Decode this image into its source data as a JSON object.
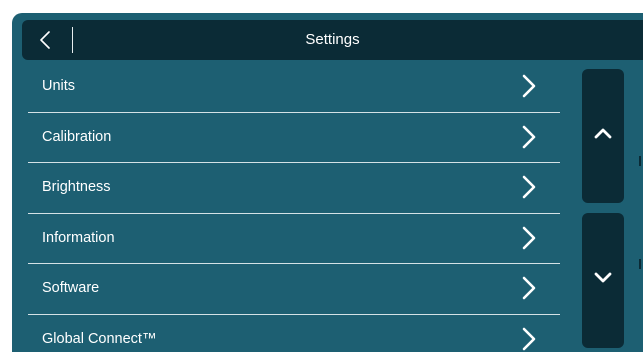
{
  "header": {
    "title": "Settings",
    "back_icon": "chevron-left-icon"
  },
  "menu": {
    "items": [
      {
        "label": "Units",
        "icon": "chevron-right-icon"
      },
      {
        "label": "Calibration",
        "icon": "chevron-right-icon"
      },
      {
        "label": "Brightness",
        "icon": "chevron-right-icon"
      },
      {
        "label": "Information",
        "icon": "chevron-right-icon"
      },
      {
        "label": "Software",
        "icon": "chevron-right-icon"
      },
      {
        "label": "Global Connect™",
        "icon": "chevron-right-icon"
      }
    ]
  },
  "scroll": {
    "up_icon": "chevron-up-icon",
    "down_icon": "chevron-down-icon"
  },
  "colors": {
    "background": "#1d5f72",
    "header": "#0b2b36",
    "text": "#ffffff",
    "divider": "#d4e2e6"
  }
}
